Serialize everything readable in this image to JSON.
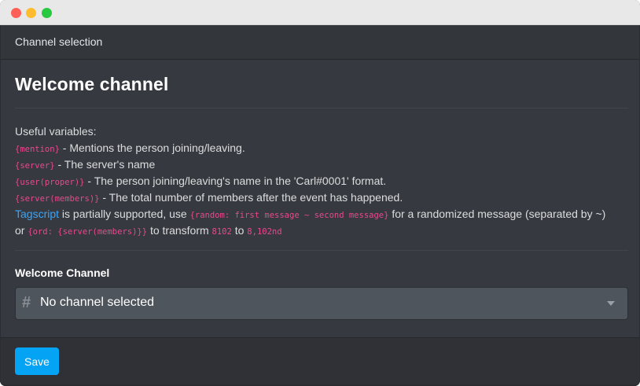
{
  "header": {
    "title": "Channel selection"
  },
  "section": {
    "title": "Welcome channel"
  },
  "variables": {
    "intro": "Useful variables:",
    "items": [
      {
        "code": "{mention}",
        "desc": " - Mentions the person joining/leaving."
      },
      {
        "code": "{server}",
        "desc": " - The server's name"
      },
      {
        "code": "{user(proper)}",
        "desc": " - The person joining/leaving's name in the 'Carl#0001' format."
      },
      {
        "code": "{server(members)}",
        "desc": " - The total number of members after the event has happened."
      }
    ],
    "tagscript": {
      "link": "Tagscript",
      "text1": " is partially supported, use ",
      "code1": "{random: first message ~ second message}",
      "text2": " for a randomized message (separated by ~)",
      "text3": "or ",
      "code2": "{ord: {server(members)}}",
      "text4": " to transform ",
      "code3": "8102",
      "text5": " to ",
      "code4": "8,102nd"
    }
  },
  "field": {
    "label": "Welcome Channel",
    "hash_glyph": "#",
    "selected_value": "No channel selected"
  },
  "footer": {
    "save_label": "Save"
  },
  "colors": {
    "accent": "#04a3f3",
    "code": "#e8498f",
    "link": "#3aa5f7",
    "background": "#36393f"
  }
}
